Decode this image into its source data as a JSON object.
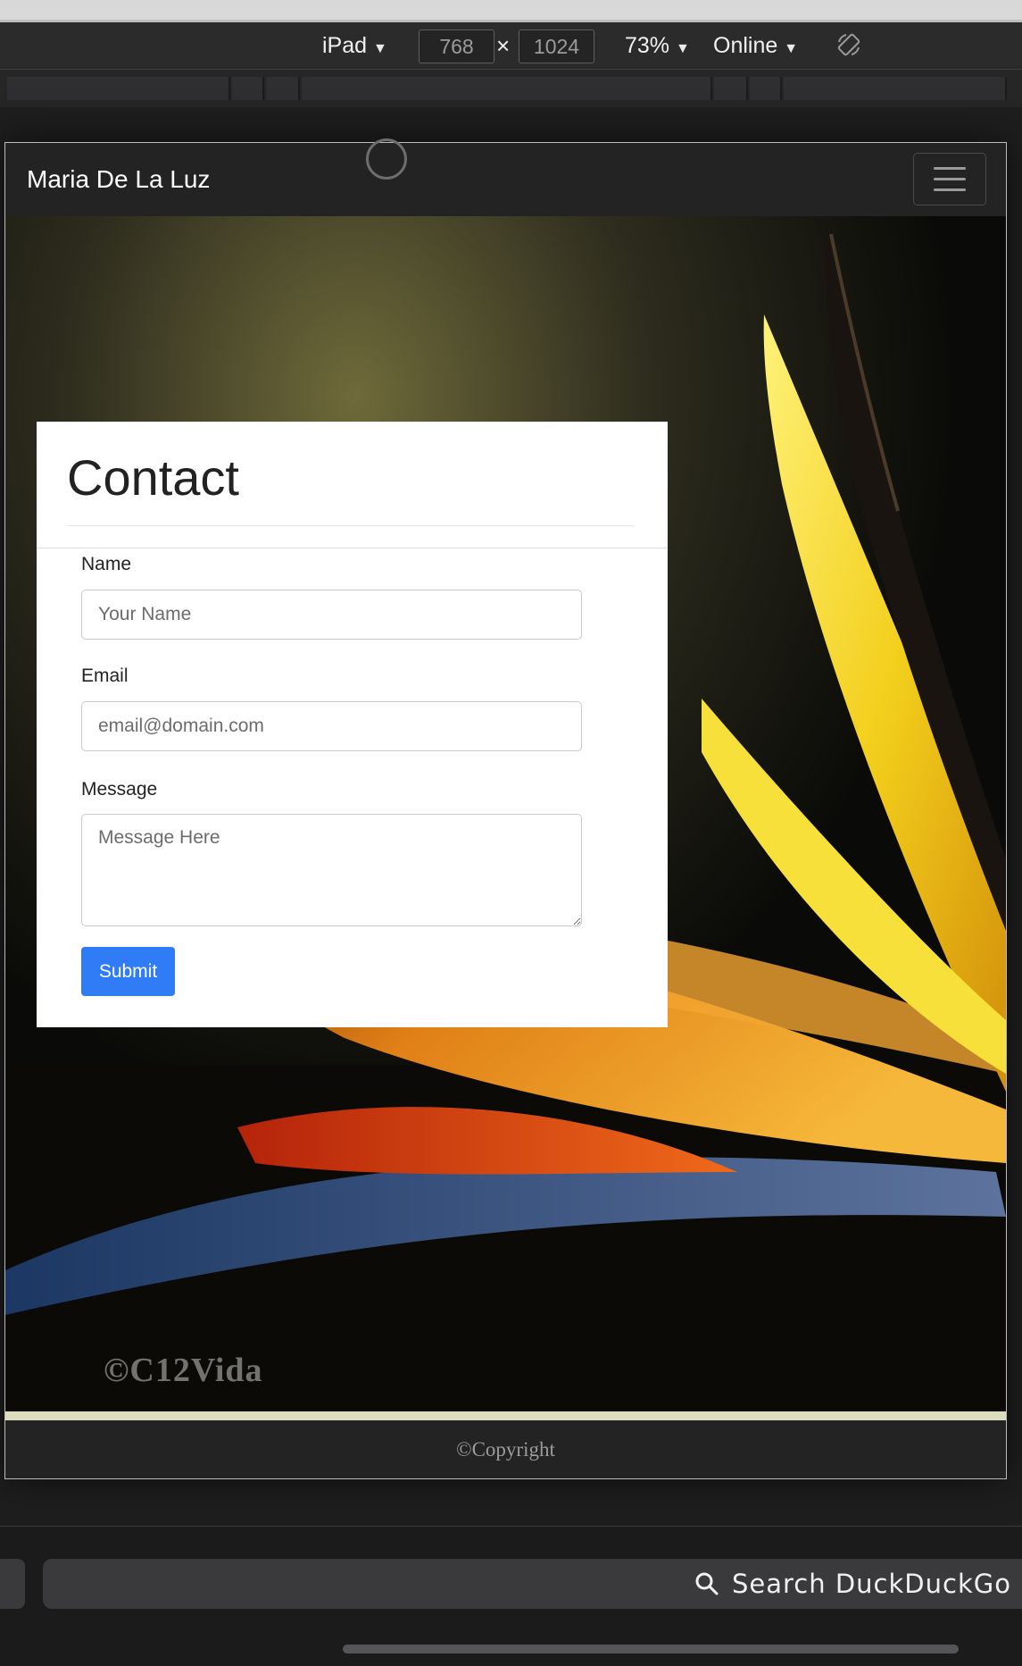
{
  "toolbar": {
    "device": "iPad",
    "width": "768",
    "times": "×",
    "height": "1024",
    "zoom": "73%",
    "network": "Online",
    "arrow": "▼"
  },
  "site": {
    "brand": "Maria De La Luz",
    "watermark": "©C12Vida",
    "footer": "©Copyright"
  },
  "contact": {
    "title": "Contact",
    "name_label": "Name",
    "name_placeholder": "Your Name",
    "email_label": "Email",
    "email_placeholder": "email@domain.com",
    "message_label": "Message",
    "message_placeholder": "Message Here",
    "submit": "Submit"
  },
  "browser": {
    "search_placeholder": "Search DuckDuckGo"
  },
  "colors": {
    "accent": "#2f7cf6",
    "navbar": "#232324"
  }
}
